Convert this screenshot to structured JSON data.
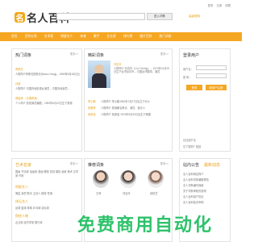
{
  "top_links": [
    "登录",
    "注册",
    "收藏"
  ],
  "header": {
    "logo_char": "名",
    "logo_text": "名人百科",
    "search_placeholder": "",
    "search_button": "进入词条",
    "hot_label": "高级搜索"
  },
  "nav": [
    "首页",
    "百科分类",
    "艺术家",
    "明星艺人",
    "体育",
    "歌手",
    "企业家",
    "排行榜",
    "图片百科",
    "热门词条"
  ],
  "hot_panel": {
    "title": "热门词条",
    "more": "更多>>",
    "items": [
      {
        "name": "黄荣亮",
        "desc": "人物简介黄荣亮是歌手(Baccc Hong)，1980年5月26日出生"
      },
      {
        "name": "孙俪",
        "desc": "人物简介 中国内地影视女演员、中国内地演员…"
      },
      {
        "name": "周星驰 （中国香港）",
        "desc": "个人简介 影视演员编剧，1962年6月22日生于香港"
      }
    ]
  },
  "rec_panel": {
    "title": "精彩词条",
    "more": "更多>>",
    "featured": "刘志玲",
    "featured_desc": "人物简介 刘志玲（Lin Chi-ling），1974年11月29日生于台湾台中市，中国台湾模特、演员",
    "items": [
      {
        "name": "李小鹏",
        "desc": "人物简介 李小鹏1981年7月27日出生于长沙"
      },
      {
        "name": "张国荣",
        "desc": "人物简介 香港著名歌手、演员、音乐人"
      },
      {
        "name": "吴彦祖",
        "desc": "人物简介 吴彦祖 1974年9月30日出生于美国"
      }
    ]
  },
  "login_panel": {
    "title": "登录用户",
    "user_label": "用户名：",
    "pass_label": "密  码：",
    "login_btn": "登录",
    "register_btn": "新用户注册",
    "remember": "记住用户名",
    "forgot": "忘了密码？找回"
  },
  "art_panel": {
    "title": "艺术名家",
    "more": "更多>>",
    "row1": [
      "国画",
      "书法家",
      "油画家",
      "漫画",
      "雕刻",
      "篆刻",
      "摄影",
      "画家",
      "美术",
      "文学家",
      "作家"
    ],
    "section2": "明星艺人",
    "row2": [
      "明星",
      "演员",
      "歌手",
      "主持人",
      "模特",
      "导演"
    ],
    "section3": "体坛名人",
    "row3": [
      "足球",
      "篮球",
      "排球",
      "乒乓球",
      "羽毛球"
    ],
    "section4": "财经人物",
    "row4": [
      "企业家",
      "经济学家",
      "银行家"
    ]
  },
  "rec2_panel": {
    "title": "推荐词条",
    "more": "更多>>",
    "people": [
      "王菲",
      "刘嘉玲",
      "张柏芝"
    ]
  },
  "news_panel": {
    "tab1": "站内公告",
    "tab2": "最新动态",
    "items": [
      "名人百科网站简介",
      "名人百科词条编辑规范",
      "名人词条编写指南",
      "关于词条审核的说明",
      "名人百科用户协议",
      "名人百科免责声明"
    ]
  },
  "banner": "免费商用自动化"
}
